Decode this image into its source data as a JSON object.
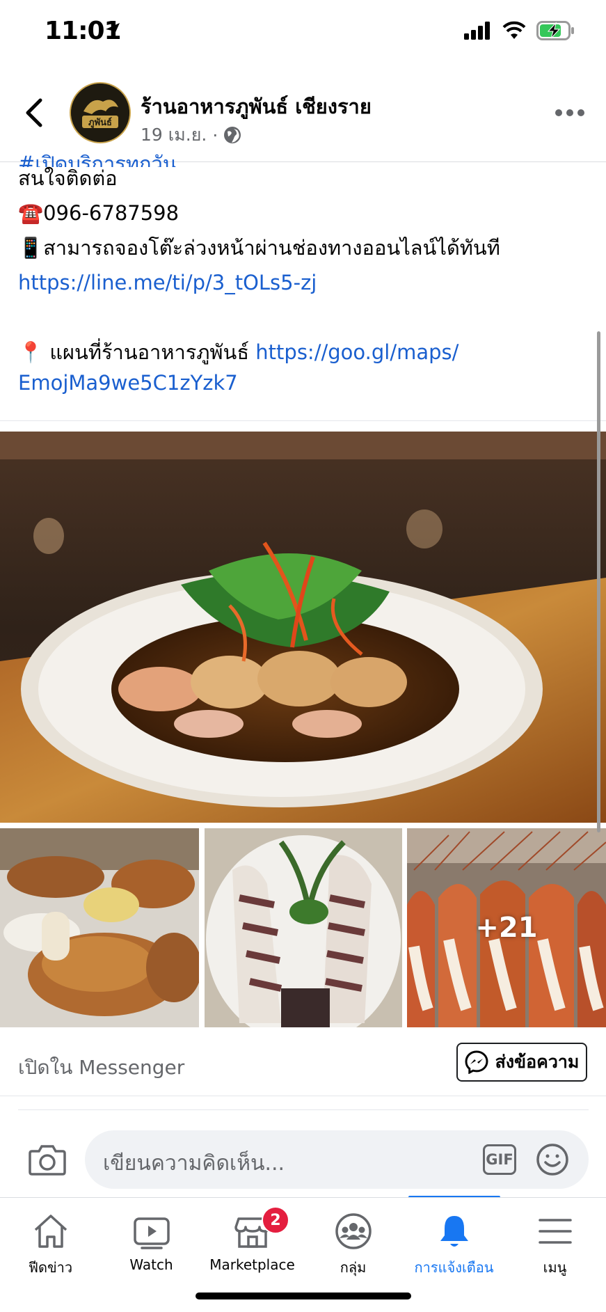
{
  "status_bar": {
    "time": "11:01"
  },
  "header": {
    "page_name": "ร้านอาหารภูพันธ์ เชียงราย",
    "date": "19 เม.ย.",
    "separator": "·",
    "avatar_text": "ภูพันธ์"
  },
  "post": {
    "hashtag_clipped": "#เปิดบริการทุกวัน",
    "contact_label": "สนใจติดต่อ",
    "phone_emoji": "☎️",
    "phone": "096-6787598",
    "mobile_emoji": "📱",
    "booking_text": "สามารถจองโต๊ะล่วงหน้าผ่านช่องทางออนไลน์ได้ทันที",
    "line_link": "https://line.me/ti/p/3_tOLs5-zj",
    "pin_emoji": "📍",
    "map_label": "แผนที่ร้านอาหารภูพันธ์",
    "map_link_part1": "https://goo.gl/maps/",
    "map_link_part2": "EmojMa9we5C1zYzk7"
  },
  "photos": {
    "more_count": "+21"
  },
  "messenger": {
    "open_label": "เปิดใน Messenger",
    "send_label": "ส่งข้อความ"
  },
  "comment": {
    "placeholder": "เขียนความคิดเห็น...",
    "gif_label": "GIF"
  },
  "tabs": [
    {
      "label": "ฟีดข่าว",
      "icon": "home-icon"
    },
    {
      "label": "Watch",
      "icon": "watch-icon"
    },
    {
      "label": "Marketplace",
      "icon": "marketplace-icon",
      "badge": "2"
    },
    {
      "label": "กลุ่ม",
      "icon": "groups-icon"
    },
    {
      "label": "การแจ้งเตือน",
      "icon": "bell-icon",
      "active": true
    },
    {
      "label": "เมนู",
      "icon": "menu-icon"
    }
  ],
  "colors": {
    "accent": "#1877f2",
    "link": "#1a5fcf",
    "badge": "#e41e3f"
  }
}
